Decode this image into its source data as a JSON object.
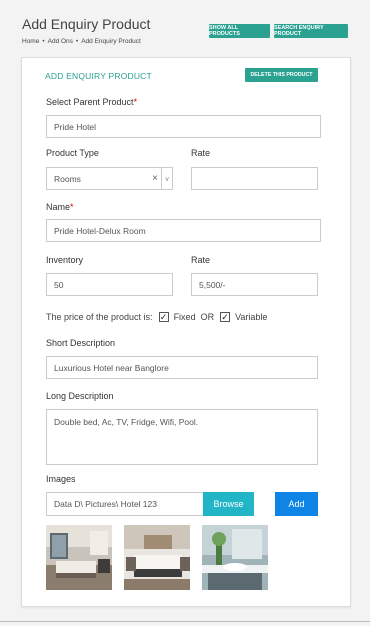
{
  "header": {
    "title": "Add Enquiry Product",
    "breadcrumb": [
      "Home",
      "Add Ons",
      "Add Enquiry Product"
    ],
    "show_all_label": "SHOW ALL PRODUCTS",
    "search_label": "SEARCH ENQUIRY PRODUCT"
  },
  "form": {
    "title": "ADD ENQUIRY PRODUCT",
    "delete_label": "DELETE THIS PRODUCT",
    "parent_product_label": "Select Parent Product",
    "parent_product_value": "Pride Hotel",
    "product_type_label": "Product Type",
    "product_type_value": "Rooms",
    "rate_label_top": "Rate",
    "rate_value_top": "",
    "name_label": "Name",
    "name_value": "Pride Hotel-Delux Room",
    "inventory_label": "Inventory",
    "inventory_value": "50",
    "rate_label": "Rate",
    "rate_value": "5,500/-",
    "price_text": "The price of the product is:",
    "fixed_label": "Fixed",
    "or_text": "OR",
    "variable_label": "Variable",
    "short_desc_label": "Short Description",
    "short_desc_value": "Luxurious Hotel near Banglore",
    "long_desc_label": "Long Description",
    "long_desc_value": "Double bed, Ac, TV, Fridge, Wifi, Pool.",
    "images_label": "Images",
    "image_path_value": "Data D\\ Pictures\\ Hotel 123",
    "browse_label": "Browse",
    "add_label": "Add",
    "required_mark": "*"
  }
}
